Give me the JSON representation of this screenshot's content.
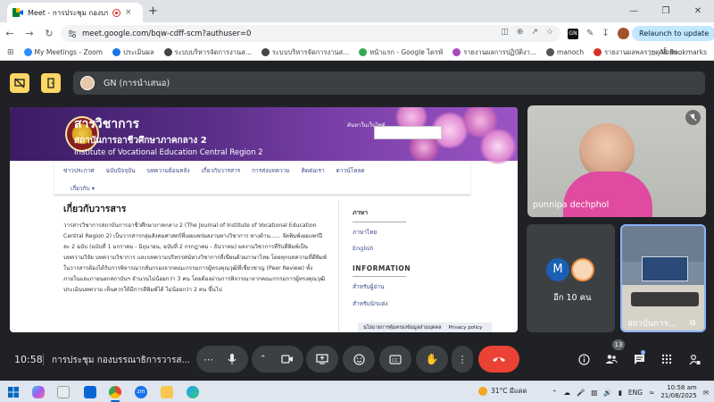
{
  "browser": {
    "tab_title": "Meet - การประชุม กองบรรณาธิ",
    "tab_close": "×",
    "new_tab": "+",
    "window_controls": [
      "—",
      "❐",
      "✕"
    ],
    "url": "meet.google.com/bqw-cdff-scm?authuser=0",
    "relaunch_label": "Relaunch to update",
    "all_bookmarks": "All Bookmarks",
    "bookmarks": [
      {
        "label": "My Meetings - Zoom",
        "color": "#2d8cff"
      },
      {
        "label": "ประเมินผล",
        "color": "#1a73e8"
      },
      {
        "label": "ระบบบริหารจัดการงานส...",
        "color": "#444444"
      },
      {
        "label": "ระบบบริหารจัดการงานส...",
        "color": "#444444"
      },
      {
        "label": "หน้าแรก - Google ไดรฟ์",
        "color": "#34a853"
      },
      {
        "label": "รายงานผลการปฏิบัติงา...",
        "color": "#ab47bc"
      },
      {
        "label": "manoch",
        "color": "#555555"
      },
      {
        "label": "รายงานผลพลรายตุ ทั้งสพ...",
        "color": "#d93025"
      }
    ]
  },
  "meet": {
    "presenter_label": "GN (การนำเสนอ)",
    "clock": "10:58",
    "meeting_name": "การประชุม กองบรรณาธิการวารส...",
    "participants_count": "13",
    "participants": [
      {
        "name": "punnipa dechphol"
      },
      {
        "initial": "M",
        "name": "อีก 10 คน"
      },
      {
        "name": "สถาบันการ..."
      }
    ],
    "colors": {
      "end_call": "#ea4335",
      "top_buttons": "#fdd663",
      "avatar_m": "#1a5fb4"
    }
  },
  "shared_screen": {
    "site_title": "สารวิชาการ",
    "site_subtitle": "สถาบันการอาชีวศึกษาภาคกลาง 2",
    "site_subtitle_en": "Institute of Vocational Education Central Region 2",
    "search_label": "ค้นหาในเว็บไซต์",
    "nav_row1": [
      "ข่าวประกาศ",
      "ฉบับปัจจุบัน",
      "บทความย้อนหลัง",
      "เกี่ยวกับวารสาร",
      "การส่งบทความ",
      "ติดต่อเรา",
      "ดาวน์โหลด"
    ],
    "nav_row2": [
      "เกี่ยวกับ ▾"
    ],
    "heading": "เกี่ยวกับวารสาร",
    "paragraph": "วารสารวิชาการสถาบันการอาชีวศึกษาภาคกลาง 2 (The Journal of Institute of Vocational Education Central Region 2) เป็นวารสารกลุ่มสังคมศาสตร์ที่เผยแพร่ผลงานทางวิชาการ ทางด้าน...... จัดพิมพ์เผยแพร่ปีละ 2 ฉบับ (ฉบับที่ 1 มกราคม - มิถุนายน, ฉบับที่ 2 กรกฎาคม - ธันวาคม) ผลงานวิชาการที่รับตีพิมพ์เป็นบทความวิจัย บทความวิชาการ และบทความปริทรรศน์ทางวิชาการที่เขียนด้วยภาษาไทย โดยทุกบทความที่ตีพิมพ์ในวารสารต้องได้รับการพิจารณากลั่นกรองจากคณะกรรมการผู้ทรงคุณวุฒิที่เชี่ยวชาญ (Peer Review) ทั้งภายในและภายนอกสถาบันฯ จำนวนไม่น้อยกว่า 3 คน โดยต้องผ่านการพิจารณาจากคณะกรรมการผู้ทรงคุณวุฒิประเมินบทความ เห็นควรให้มีการตีพิมพ์ได้ ไม่น้อยกว่า 2 คน ขึ้นไป",
    "sidebar": {
      "lang_heading": "ภาษา",
      "lang_links": [
        "ภาษาไทย",
        "English"
      ],
      "info_heading": "INFORMATION",
      "info_links": [
        "สำหรับผู้อ่าน",
        "สำหรับนักแต่ง"
      ]
    },
    "cookie_bar": [
      "นโยบายการคุ้มครองข้อมูลส่วนบุคคล",
      "Privacy policy"
    ]
  },
  "taskbar": {
    "weather": "31°C มีแดด",
    "lang": "ENG",
    "time": "10:58 am",
    "date": "21/08/2025"
  }
}
